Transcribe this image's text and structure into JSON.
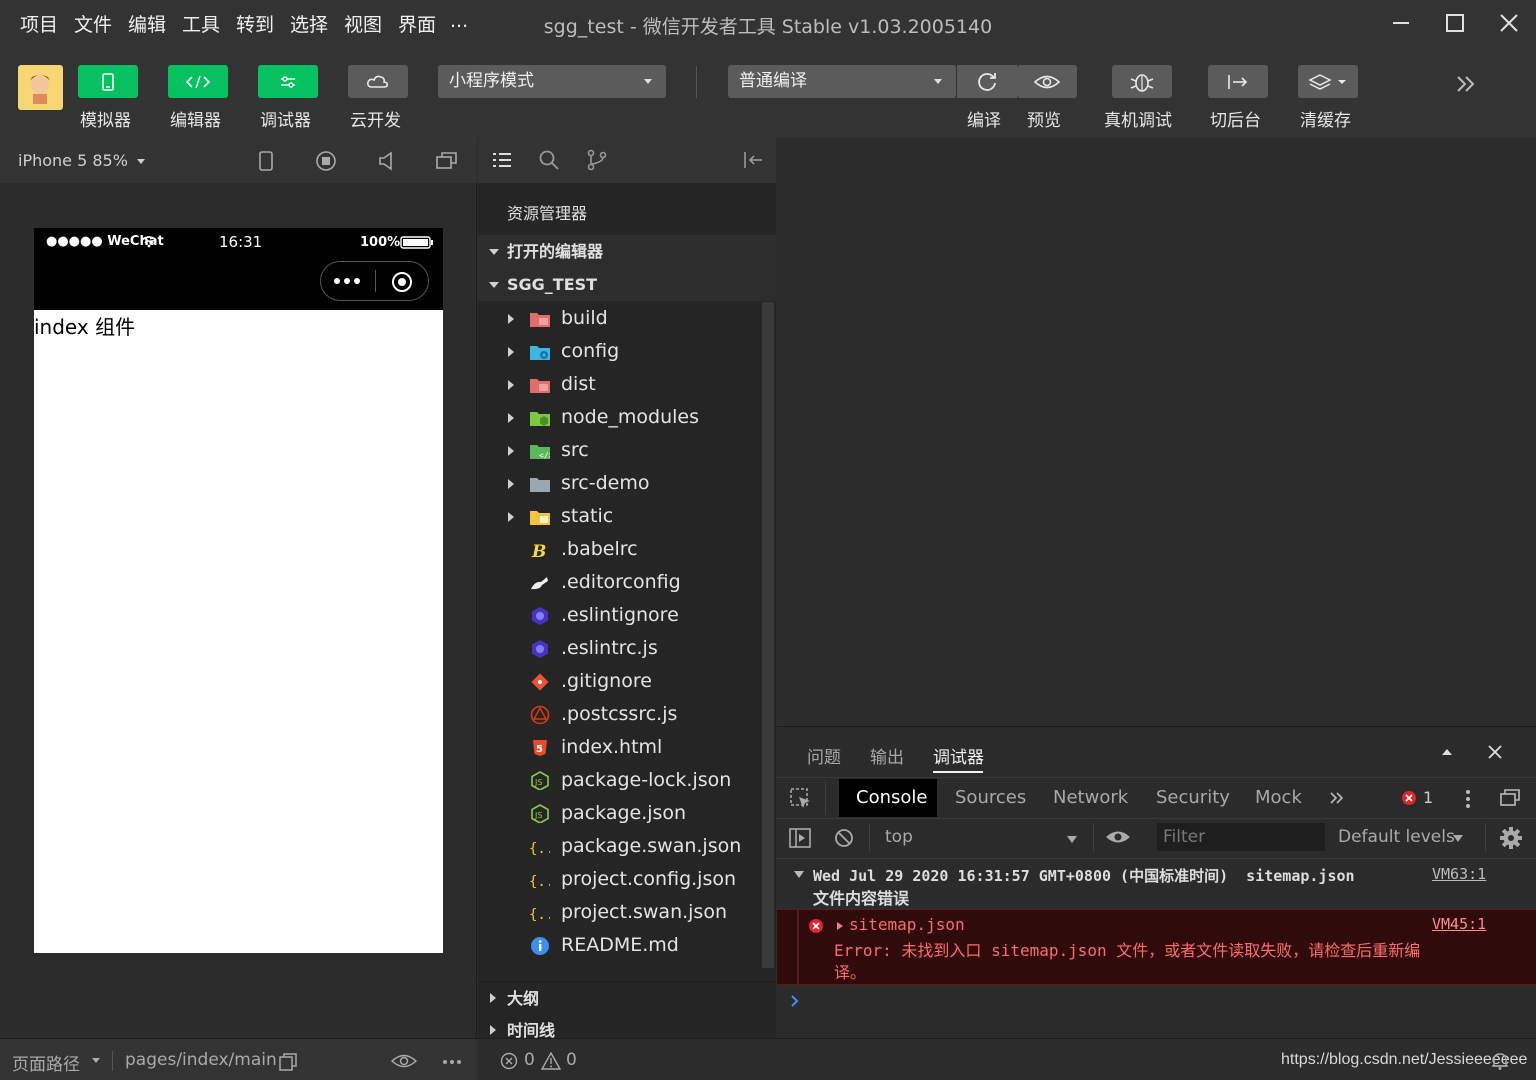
{
  "menu": [
    "项目",
    "文件",
    "编辑",
    "工具",
    "转到",
    "选择",
    "视图",
    "界面",
    "..."
  ],
  "window_title": "sgg_test - 微信开发者工具 Stable v1.03.2005140",
  "toolbar": {
    "simulator": "模拟器",
    "editor": "编辑器",
    "debugger": "调试器",
    "cloud": "云开发",
    "mode": "小程序模式",
    "compile_mode": "普通编译",
    "compile": "编译",
    "preview": "预览",
    "real_debug": "真机调试",
    "background": "切后台",
    "clear_cache": "清缓存"
  },
  "simulator": {
    "device": "iPhone 5 85%",
    "status_left": "●●●●● WeChat",
    "time": "16:31",
    "battery": "100%",
    "content_text": "index 组件"
  },
  "explorer": {
    "title": "资源管理器",
    "open_editors": "打开的编辑器",
    "project": "SGG_TEST",
    "outline": "大纲",
    "timeline": "时间线",
    "files": [
      {
        "name": "build",
        "icon": "folder-red-icon",
        "folder": true
      },
      {
        "name": "config",
        "icon": "folder-config-icon",
        "folder": true
      },
      {
        "name": "dist",
        "icon": "folder-red-icon",
        "folder": true
      },
      {
        "name": "node_modules",
        "icon": "folder-node-icon",
        "folder": true
      },
      {
        "name": "src",
        "icon": "folder-src-icon",
        "folder": true
      },
      {
        "name": "src-demo",
        "icon": "folder-gray-icon",
        "folder": true
      },
      {
        "name": "static",
        "icon": "folder-yellow-icon",
        "folder": true
      },
      {
        "name": ".babelrc",
        "icon": "babel-icon",
        "folder": false
      },
      {
        "name": ".editorconfig",
        "icon": "editorconfig-icon",
        "folder": false
      },
      {
        "name": ".eslintignore",
        "icon": "eslint-icon",
        "folder": false
      },
      {
        "name": ".eslintrc.js",
        "icon": "eslint-icon",
        "folder": false
      },
      {
        "name": ".gitignore",
        "icon": "git-icon",
        "folder": false
      },
      {
        "name": ".postcssrc.js",
        "icon": "postcss-icon",
        "folder": false
      },
      {
        "name": "index.html",
        "icon": "html5-icon",
        "folder": false
      },
      {
        "name": "package-lock.json",
        "icon": "nodejs-icon",
        "folder": false
      },
      {
        "name": "package.json",
        "icon": "nodejs-icon",
        "folder": false
      },
      {
        "name": "package.swan.json",
        "icon": "json-icon",
        "folder": false
      },
      {
        "name": "project.config.json",
        "icon": "json-icon",
        "folder": false
      },
      {
        "name": "project.swan.json",
        "icon": "json-icon",
        "folder": false
      },
      {
        "name": "README.md",
        "icon": "info-icon",
        "folder": false
      }
    ]
  },
  "debug": {
    "tabs": [
      "问题",
      "输出",
      "调试器"
    ],
    "devtools_tabs": [
      "Console",
      "Sources",
      "Network",
      "Security",
      "Mock"
    ],
    "error_count": "1",
    "context": "top",
    "filter_placeholder": "Filter",
    "levels": "Default levels",
    "log_group": "Wed Jul 29 2020 16:31:57 GMT+0800 (中国标准时间)  sitemap.json",
    "log_group_sub": "文件内容错误",
    "log_group_src": "VM63:1",
    "error_title": "sitemap.json",
    "error_src": "VM45:1",
    "error_line1": "Error: 未找到入口 sitemap.json 文件，或者文件读取失败，请检查后重新编",
    "error_line2": "译。"
  },
  "statusbar": {
    "path_label": "页面路径",
    "path": "pages/index/main",
    "errors": "0",
    "warnings": "0",
    "watermark": "https://blog.csdn.net/Jessieeeeeee"
  },
  "colors": {
    "green": "#07c160",
    "error_bg": "#3b0a0a",
    "error_text": "#ff6b6b"
  }
}
